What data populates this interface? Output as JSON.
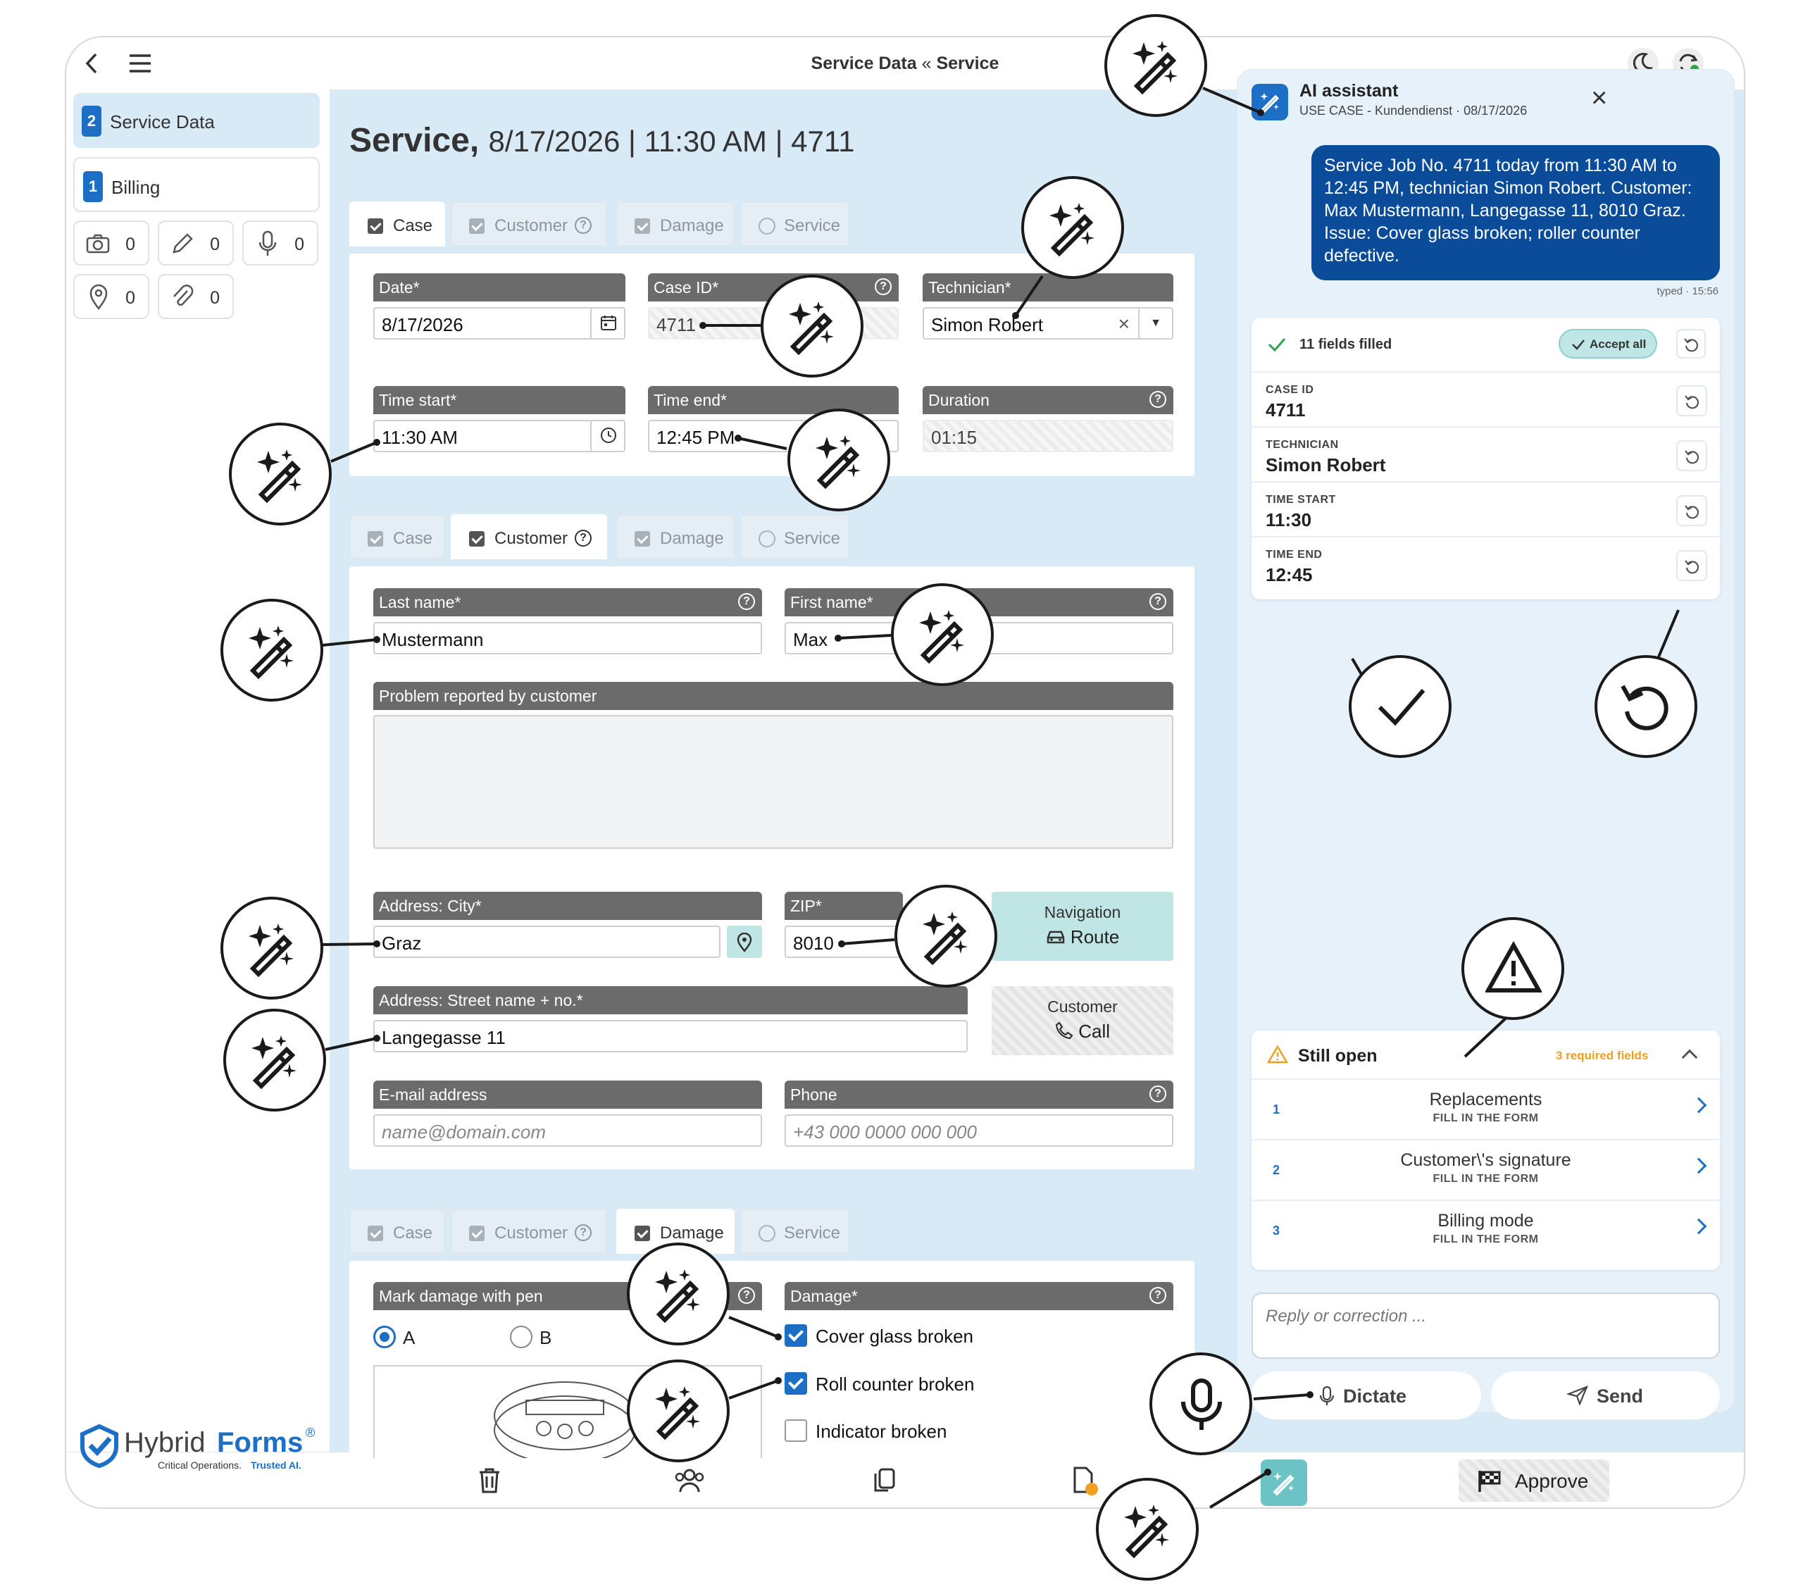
{
  "header": {
    "title": "Service Data",
    "sep": "«",
    "title2": "Service"
  },
  "sidebar": {
    "items": [
      {
        "badge": "2",
        "label": "Service Data"
      },
      {
        "badge": "1",
        "label": "Billing"
      }
    ],
    "counters": [
      "0",
      "0",
      "0",
      "0",
      "0"
    ]
  },
  "brand": {
    "name1": "Hybrid",
    "name2": "Forms",
    "reg": "®",
    "tag1": "Critical Operations.",
    "tag2": "Trusted AI."
  },
  "page": {
    "title_bold": "Service,",
    "title_rest": "8/17/2026 | 11:30 AM | 4711"
  },
  "tabs": {
    "case": "Case",
    "customer": "Customer",
    "damage": "Damage",
    "service": "Service"
  },
  "case_form": {
    "date_label": "Date*",
    "date_value": "8/17/2026",
    "caseid_label": "Case ID*",
    "caseid_value": "4711",
    "tech_label": "Technician*",
    "tech_value": "Simon Robert",
    "clear": "×",
    "dd": "▼",
    "tstart_label": "Time start*",
    "tstart_value": "11:30 AM",
    "tend_label": "Time end*",
    "tend_value": "12:45 PM",
    "dur_label": "Duration",
    "dur_value": "01:15"
  },
  "customer_form": {
    "last_label": "Last name*",
    "last_value": "Mustermann",
    "first_label": "First name*",
    "first_value": "Max",
    "problem_label": "Problem reported by customer",
    "city_label": "Address: City*",
    "city_value": "Graz",
    "zip_label": "ZIP*",
    "zip_value": "8010",
    "nav_label": "Navigation",
    "nav_btn": "Route",
    "street_label": "Address: Street name + no.*",
    "street_value": "Langegasse 11",
    "cust_label": "Customer",
    "cust_btn": "Call",
    "email_label": "E-mail address",
    "email_ph": "name@domain.com",
    "phone_label": "Phone",
    "phone_ph": "+43 000 0000 000 000"
  },
  "damage_form": {
    "mark_label": "Mark damage with pen",
    "opt_a": "A",
    "opt_b": "B",
    "damage_label": "Damage*",
    "checks": [
      {
        "label": "Cover glass broken",
        "checked": true
      },
      {
        "label": "Roll counter broken",
        "checked": true
      },
      {
        "label": "Indicator broken",
        "checked": false
      }
    ]
  },
  "assistant": {
    "title": "AI assistant",
    "subtitle": "USE CASE - Kundendienst · 08/17/2026",
    "close": "×",
    "message": "Service Job No. 4711 today from 11:30 AM to 12:45 PM, technician Simon Robert. Customer: Max Mustermann, Langegasse 11, 8010 Graz. Issue: Cover glass broken; roller counter defective.",
    "meta": "typed · 15:56",
    "filled": {
      "summary": "11 fields filled",
      "accept": "Accept all",
      "rows": [
        {
          "key": "CASE ID",
          "value": "4711"
        },
        {
          "key": "TECHNICIAN",
          "value": "Simon Robert"
        },
        {
          "key": "TIME START",
          "value": "11:30"
        },
        {
          "key": "TIME END",
          "value": "12:45"
        }
      ]
    },
    "open": {
      "title": "Still open",
      "count": "3 required fields",
      "items": [
        {
          "n": "1",
          "title": "Replacements",
          "sub": "FILL IN THE FORM"
        },
        {
          "n": "2",
          "title": "Customer\\'s signature",
          "sub": "FILL IN THE FORM"
        },
        {
          "n": "3",
          "title": "Billing mode",
          "sub": "FILL IN THE FORM"
        }
      ]
    },
    "reply_ph": "Reply or correction ...",
    "dictate": "Dictate",
    "send": "Send"
  },
  "bottom": {
    "approve": "Approve"
  },
  "colors": {
    "accent": "#1c6fc4",
    "panel": "#e6f1fa",
    "bubble": "#0b4c9a",
    "teal": "#bfe6e4",
    "warn": "#f0a020"
  }
}
